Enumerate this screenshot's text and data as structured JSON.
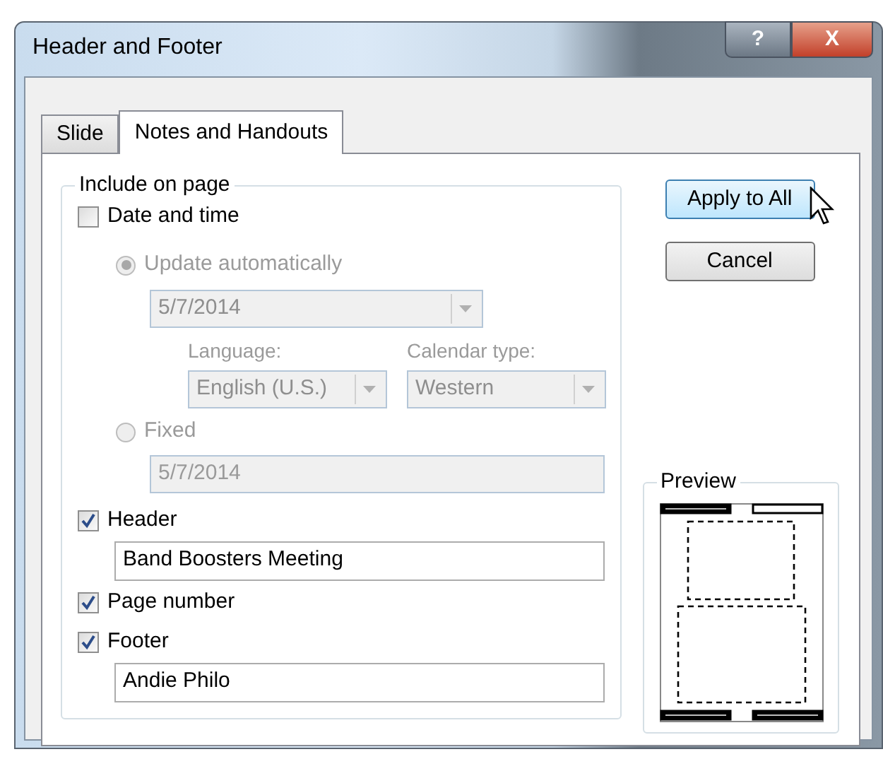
{
  "window": {
    "title": "Header and Footer",
    "title_buttons": [
      {
        "kind": "help",
        "label": "?"
      },
      {
        "kind": "close",
        "label": "X"
      }
    ]
  },
  "tabs": [
    {
      "label": "Slide",
      "selected": false
    },
    {
      "label": "Notes and Handouts",
      "selected": true
    }
  ],
  "include": {
    "title": "Include on page",
    "date_time": {
      "label": "Date and time",
      "checked": false,
      "update_automatically": {
        "label": "Update automatically",
        "selected": true,
        "value": "5/7/2014"
      },
      "language": {
        "label": "Language:",
        "value": "English (U.S.)"
      },
      "calendar_type": {
        "label": "Calendar type:",
        "value": "Western"
      },
      "fixed": {
        "label": "Fixed",
        "selected": false,
        "value": "5/7/2014"
      }
    },
    "header": {
      "label": "Header",
      "checked": true,
      "value": "Band Boosters Meeting"
    },
    "page_number": {
      "label": "Page number",
      "checked": true
    },
    "footer": {
      "label": "Footer",
      "checked": true,
      "value": "Andie Philo"
    }
  },
  "buttons": [
    {
      "label": "Apply to All",
      "hovered": true
    },
    {
      "label": "Cancel",
      "hovered": false
    }
  ],
  "preview": {
    "title": "Preview"
  }
}
